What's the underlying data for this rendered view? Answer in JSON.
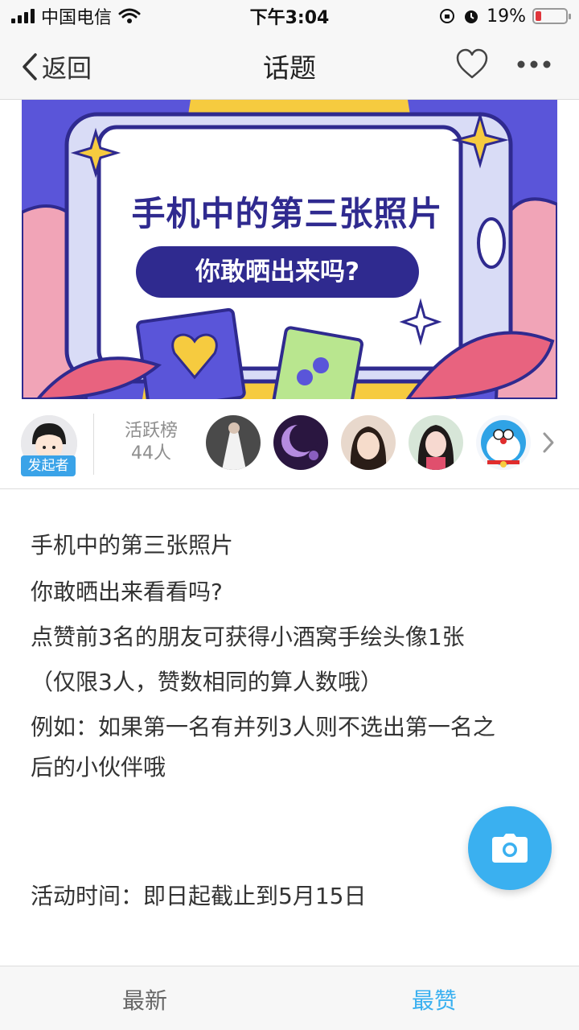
{
  "status_bar": {
    "carrier": "中国电信",
    "time": "下午3:04",
    "battery_percent": "19%",
    "battery_level": 0.19
  },
  "nav": {
    "back_label": "返回",
    "title": "话题"
  },
  "banner": {
    "title": "手机中的第三张照片",
    "subtitle": "你敢晒出来吗?"
  },
  "participants": {
    "initiator_badge": "发起者",
    "rank_label": "活跃榜",
    "rank_count": "44人"
  },
  "description": {
    "lines": [
      "手机中的第三张照片",
      "你敢晒出来看看吗?",
      "点赞前3名的朋友可获得小酒窝手绘头像1张",
      "（仅限3人，赞数相同的算人数哦）",
      "例如：如果第一名有并列3人则不选出第一名之",
      "后的小伙伴哦",
      "活动时间：即日起截止到5月15日"
    ]
  },
  "tabs": {
    "newest": "最新",
    "top": "最赞"
  },
  "colors": {
    "accent": "#3ab0f0",
    "badge": "#3aa3e8",
    "battery_low": "#e0353b"
  }
}
